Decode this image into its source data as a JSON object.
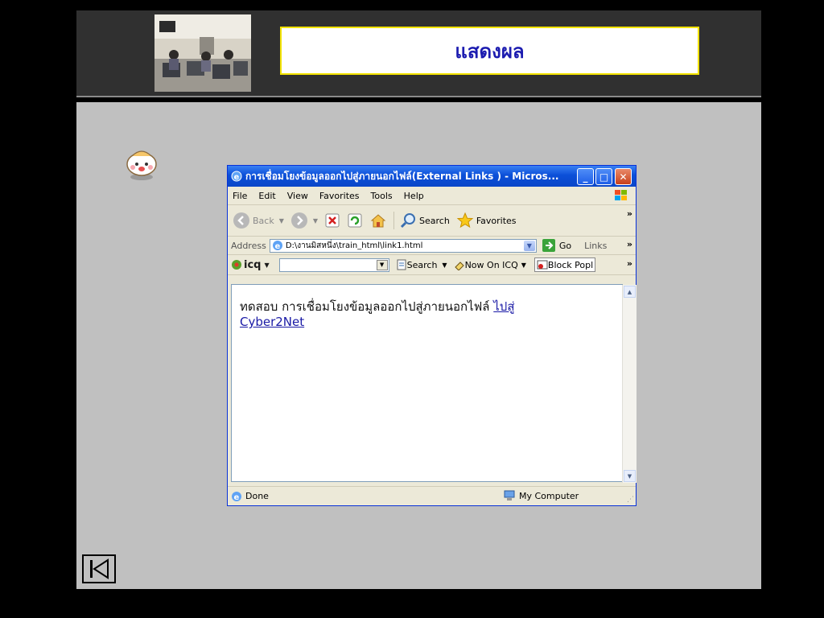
{
  "header": {
    "title": "แสดงผล"
  },
  "browser": {
    "window_title": "การเชื่อมโยงข้อมูลออกไปสู่ภายนอกไฟล์(External Links ) - Micros...",
    "menu": [
      "File",
      "Edit",
      "View",
      "Favorites",
      "Tools",
      "Help"
    ],
    "toolbar": {
      "back": "Back",
      "search": "Search",
      "favorites": "Favorites"
    },
    "address": {
      "label": "Address",
      "value": "D:\\งานมิสหนึ่ง\\train_html\\link1.html",
      "go": "Go",
      "links": "Links"
    },
    "icq": {
      "brand": "icq",
      "search": "Search",
      "now_on_icq": "Now On ICQ",
      "block_popups": "Block Popl"
    },
    "page": {
      "text": "ทดสอบ การเชื่อมโยงข้อมูลออกไปสู่ภายนอกไฟล์ ",
      "link": "ไปสู่ Cyber2Net"
    },
    "status": {
      "left": "Done",
      "zone": "My Computer"
    }
  },
  "colors": {
    "header_bg": "#303030",
    "content_bg": "#c0c0c0",
    "title_text": "#1c1cb0",
    "title_border": "#f2e300",
    "xp_blue": "#0b4fd8"
  }
}
